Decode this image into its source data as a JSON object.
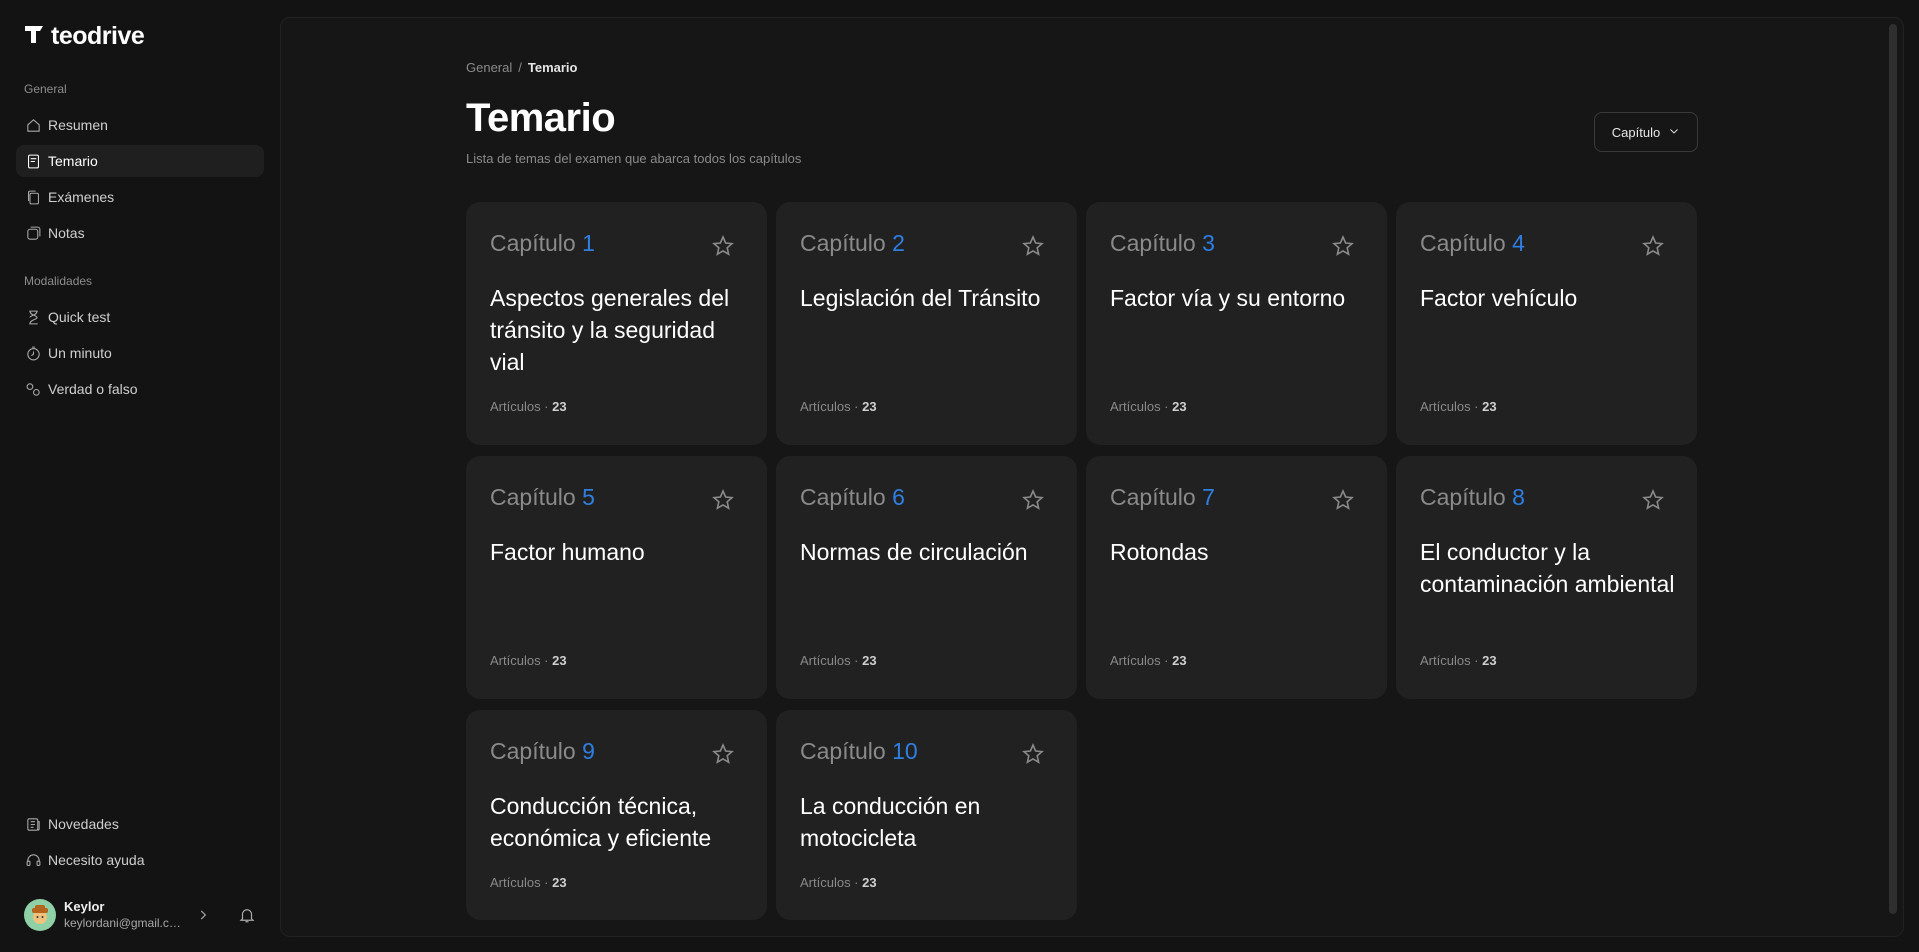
{
  "brand": {
    "name": "teodrive",
    "logo_icon": "teodrive-logo-icon"
  },
  "sidebar": {
    "sections": [
      {
        "label": "General"
      },
      {
        "label": "Modalidades"
      }
    ],
    "general_items": [
      {
        "label": "Resumen",
        "icon": "home-icon"
      },
      {
        "label": "Temario",
        "icon": "book-icon",
        "active": true
      },
      {
        "label": "Exámenes",
        "icon": "cards-icon"
      },
      {
        "label": "Notas",
        "icon": "notes-icon"
      }
    ],
    "mode_items": [
      {
        "label": "Quick test",
        "icon": "hourglass-icon"
      },
      {
        "label": "Un minuto",
        "icon": "timer-icon"
      },
      {
        "label": "Verdad o falso",
        "icon": "toggle-icon"
      }
    ],
    "bottom_items": [
      {
        "label": "Novedades",
        "icon": "newspaper-icon"
      },
      {
        "label": "Necesito ayuda",
        "icon": "headset-icon"
      }
    ],
    "user": {
      "name": "Keylor",
      "email": "keylordani@gmail.com"
    }
  },
  "breadcrumb": {
    "root": "General",
    "separator": "/",
    "current": "Temario"
  },
  "page": {
    "title": "Temario",
    "subtitle": "Lista de temas del examen que abarca todos los capítulos",
    "filter_label": "Capítulo"
  },
  "chapters": [
    {
      "prefix": "Capítulo",
      "number": "1",
      "title": "Aspectos generales del tránsito y la seguridad vial",
      "meta_label": "Artículos ·",
      "meta_count": "23"
    },
    {
      "prefix": "Capítulo",
      "number": "2",
      "title": "Legislación del Tránsito",
      "meta_label": "Artículos ·",
      "meta_count": "23"
    },
    {
      "prefix": "Capítulo",
      "number": "3",
      "title": "Factor vía y su entorno",
      "meta_label": "Artículos ·",
      "meta_count": "23"
    },
    {
      "prefix": "Capítulo",
      "number": "4",
      "title": "Factor vehículo",
      "meta_label": "Artículos ·",
      "meta_count": "23"
    },
    {
      "prefix": "Capítulo",
      "number": "5",
      "title": "Factor humano",
      "meta_label": "Artículos ·",
      "meta_count": "23"
    },
    {
      "prefix": "Capítulo",
      "number": "6",
      "title": "Normas de circulación",
      "meta_label": "Artículos ·",
      "meta_count": "23"
    },
    {
      "prefix": "Capítulo",
      "number": "7",
      "title": "Rotondas",
      "meta_label": "Artículos ·",
      "meta_count": "23"
    },
    {
      "prefix": "Capítulo",
      "number": "8",
      "title": "El conductor y la contaminación ambiental",
      "meta_label": "Artículos ·",
      "meta_count": "23"
    },
    {
      "prefix": "Capítulo",
      "number": "9",
      "title": "Conducción técnica, económica y eficiente",
      "meta_label": "Artículos ·",
      "meta_count": "23"
    },
    {
      "prefix": "Capítulo",
      "number": "10",
      "title": "La conducción en motocicleta",
      "meta_label": "Artículos ·",
      "meta_count": "23"
    }
  ],
  "colors": {
    "background": "#131313",
    "panel": "#161616",
    "card": "#212121",
    "accent": "#2f7fe3",
    "muted_text": "#8a8a8a"
  }
}
